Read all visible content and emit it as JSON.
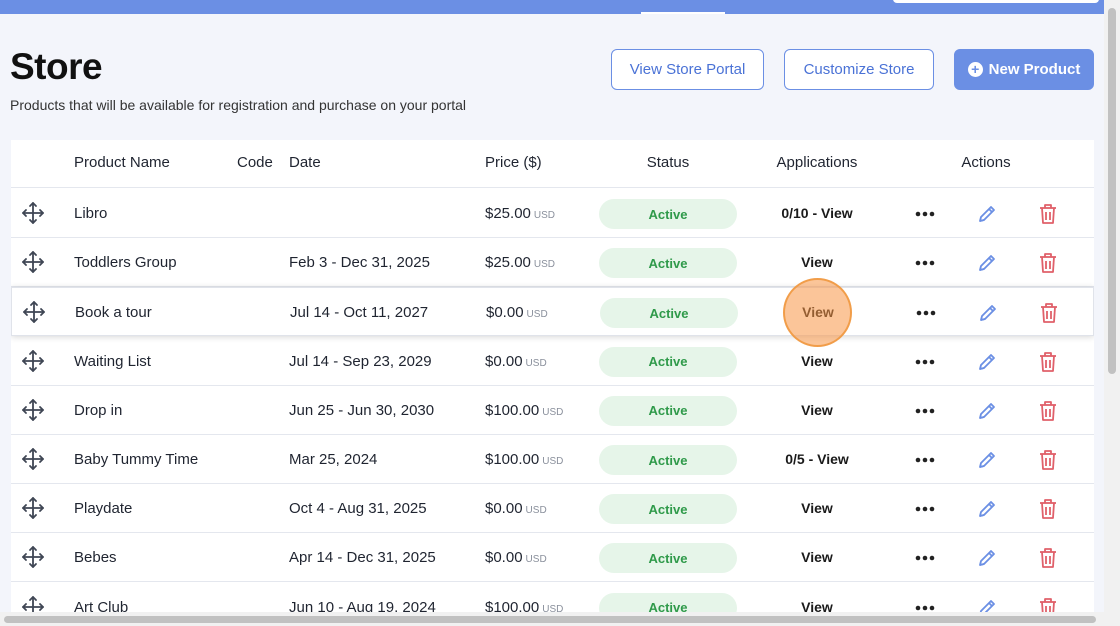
{
  "page": {
    "title": "Store",
    "subtitle": "Products that will be available for registration and purchase on your portal"
  },
  "actions": {
    "view_portal": "View Store Portal",
    "customize": "Customize Store",
    "new_product": "New Product"
  },
  "table": {
    "headers": {
      "name": "Product Name",
      "code": "Code",
      "date": "Date",
      "price": "Price ($)",
      "status": "Status",
      "applications": "Applications",
      "actions": "Actions"
    },
    "currency": "USD",
    "rows": [
      {
        "name": "Libro",
        "code": "",
        "date": "",
        "price": "$25.00",
        "status": "Active",
        "applications": "0/10 - View"
      },
      {
        "name": "Toddlers Group",
        "code": "",
        "date": "Feb 3 - Dec 31, 2025",
        "price": "$25.00",
        "status": "Active",
        "applications": "View"
      },
      {
        "name": "Book a tour",
        "code": "",
        "date": "Jul 14 - Oct 11, 2027",
        "price": "$0.00",
        "status": "Active",
        "applications": "View"
      },
      {
        "name": "Waiting List",
        "code": "",
        "date": "Jul 14 - Sep 23, 2029",
        "price": "$0.00",
        "status": "Active",
        "applications": "View"
      },
      {
        "name": "Drop in",
        "code": "",
        "date": "Jun 25 - Jun 30, 2030",
        "price": "$100.00",
        "status": "Active",
        "applications": "View"
      },
      {
        "name": "Baby Tummy Time",
        "code": "",
        "date": "Mar 25, 2024",
        "price": "$100.00",
        "status": "Active",
        "applications": "0/5 - View"
      },
      {
        "name": "Playdate",
        "code": "",
        "date": "Oct 4 - Aug 31, 2025",
        "price": "$0.00",
        "status": "Active",
        "applications": "View"
      },
      {
        "name": "Bebes",
        "code": "",
        "date": "Apr 14 - Dec 31, 2025",
        "price": "$0.00",
        "status": "Active",
        "applications": "View"
      },
      {
        "name": "Art Club",
        "code": "",
        "date": "Jun 10 - Aug 19, 2024",
        "price": "$100.00",
        "status": "Active",
        "applications": "View"
      }
    ]
  },
  "colors": {
    "accent": "#6b8fe4",
    "status_bg": "#e6f5e9",
    "status_text": "#2f9a4a",
    "delete": "#e0606a",
    "edit": "#6b8fe4"
  }
}
